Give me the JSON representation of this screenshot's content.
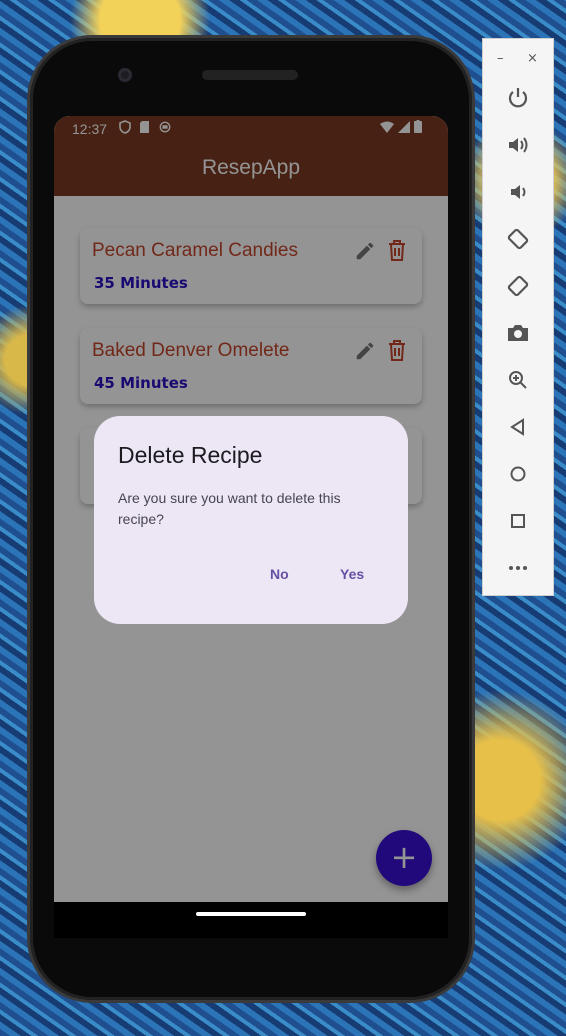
{
  "status_bar": {
    "time": "12:37"
  },
  "app": {
    "title": "ResepApp"
  },
  "recipes": [
    {
      "title": "Pecan Caramel Candies",
      "duration": "35 Minutes"
    },
    {
      "title": "Baked Denver Omelete",
      "duration": "45 Minutes"
    },
    {
      "title": "",
      "duration": ""
    }
  ],
  "dialog": {
    "title": "Delete Recipe",
    "message": "Are you sure you want to delete this recipe?",
    "no_label": "No",
    "yes_label": "Yes"
  },
  "fab": {
    "label": "+"
  },
  "emulator_panel": {
    "minimize_label": "–",
    "close_label": "×",
    "tools": [
      "power-icon",
      "volume-up-icon",
      "volume-down-icon",
      "rotate-left-icon",
      "rotate-right-icon",
      "camera-icon",
      "zoom-icon",
      "back-icon",
      "home-icon",
      "overview-icon",
      "more-icon"
    ]
  },
  "colors": {
    "appbar": "#7b3a22",
    "recipe_title": "#c4462b",
    "duration": "#2b12c4",
    "fab": "#3a10d6",
    "dialog_bg": "#ece6f5",
    "dialog_button": "#6750a4"
  }
}
